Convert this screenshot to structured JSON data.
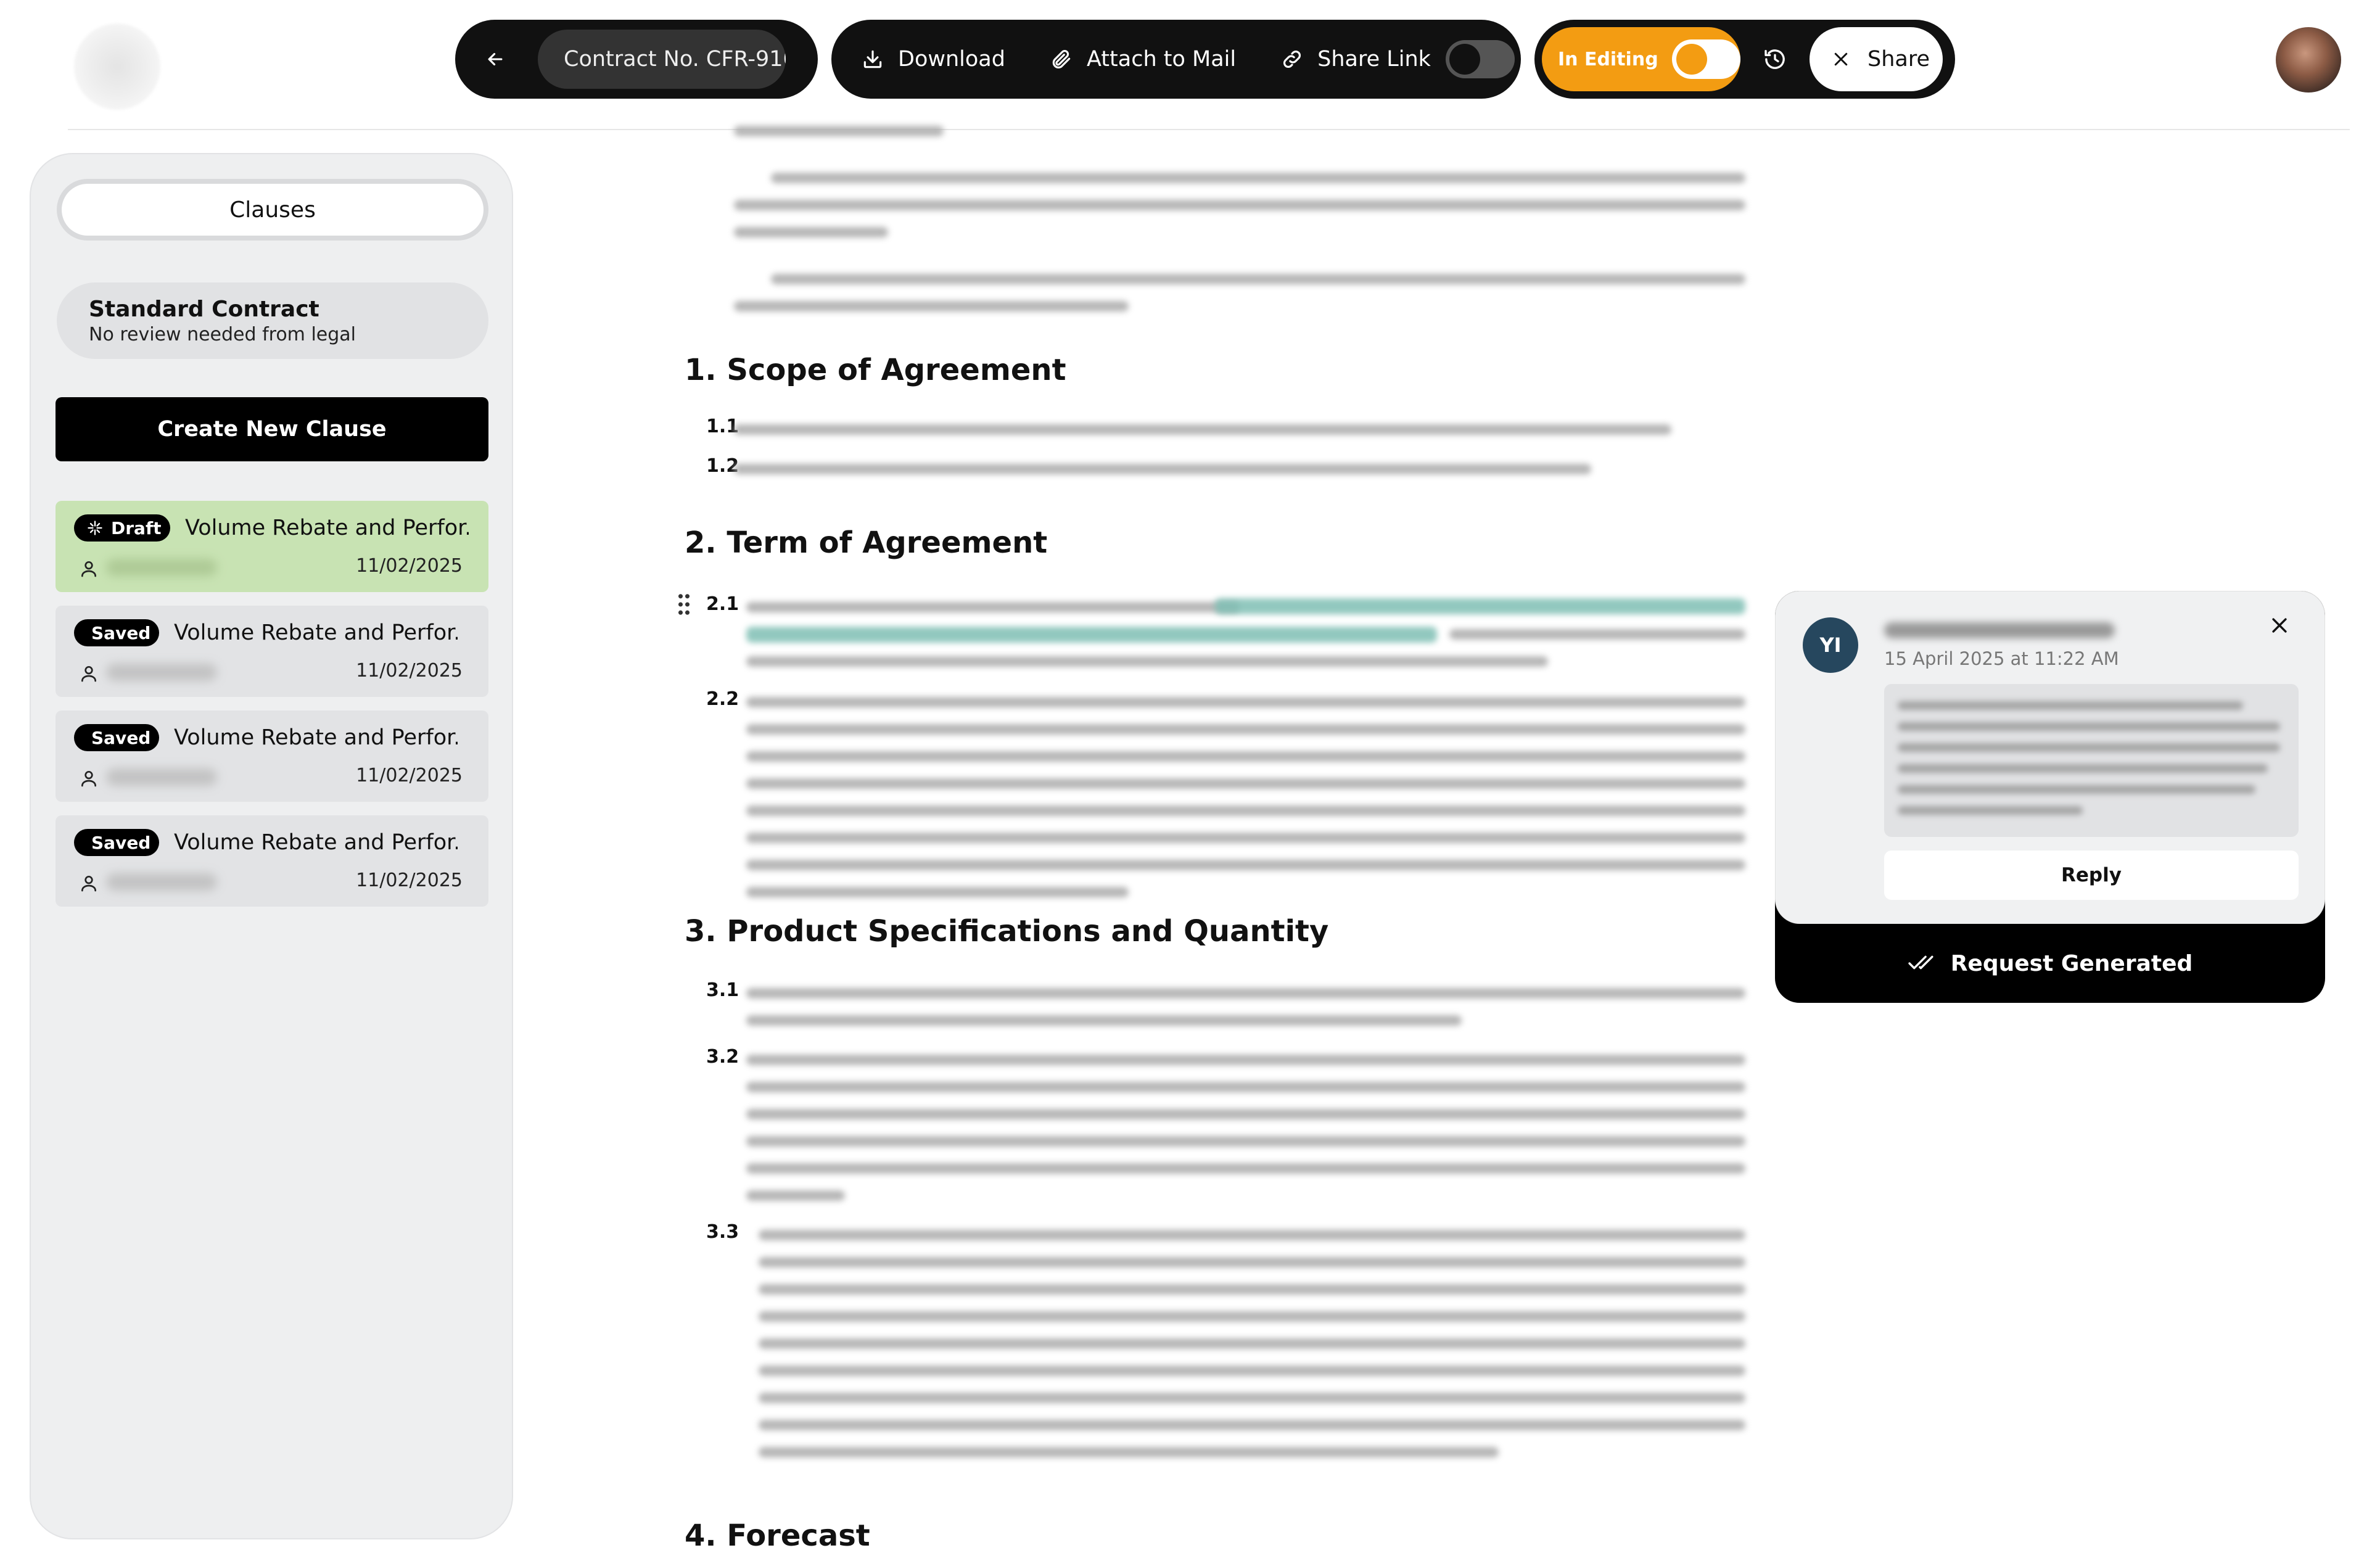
{
  "toolbar": {
    "contract_no": "Contract No. CFR-910...",
    "download_label": "Download",
    "attach_label": "Attach to Mail",
    "share_link_label": "Share Link",
    "editing_label": "In Editing",
    "share_label": "Share"
  },
  "sidebar": {
    "tab_label": "Clauses",
    "standard": {
      "title": "Standard Contract",
      "subtitle": "No review needed from legal"
    },
    "create_label": "Create New Clause",
    "clauses": [
      {
        "status": "Draft",
        "title": "Volume Rebate and Perfor...",
        "date": "11/02/2025"
      },
      {
        "status": "Saved",
        "title": "Volume Rebate and Perfor...",
        "date": "11/02/2025"
      },
      {
        "status": "Saved",
        "title": "Volume Rebate and Perfor...",
        "date": "11/02/2025"
      },
      {
        "status": "Saved",
        "title": "Volume Rebate and Perfor...",
        "date": "11/02/2025"
      }
    ]
  },
  "document": {
    "sections": [
      {
        "heading": "1. Scope of Agreement",
        "clauses": [
          "1.1",
          "1.2"
        ]
      },
      {
        "heading": "2. Term of Agreement",
        "clauses": [
          "2.1",
          "2.2"
        ]
      },
      {
        "heading": "3. Product Specifications and Quantity",
        "clauses": [
          "3.1",
          "3.2",
          "3.3"
        ]
      },
      {
        "heading": "4. Forecast"
      }
    ]
  },
  "comment": {
    "initials": "YI",
    "date": "15 April 2025 at 11:22 AM",
    "reply_label": "Reply",
    "request_label": "Request Generated"
  },
  "icons": [
    "back-arrow-icon",
    "download-icon",
    "paperclip-icon",
    "link-icon",
    "history-icon",
    "close-icon",
    "sparkle-icon",
    "person-icon",
    "drag-handle-icon",
    "double-check-icon"
  ],
  "colors": {
    "accent": "#f39c12",
    "draft": "#c8e3b3",
    "avatar": "#26475e",
    "dark": "#111111"
  }
}
